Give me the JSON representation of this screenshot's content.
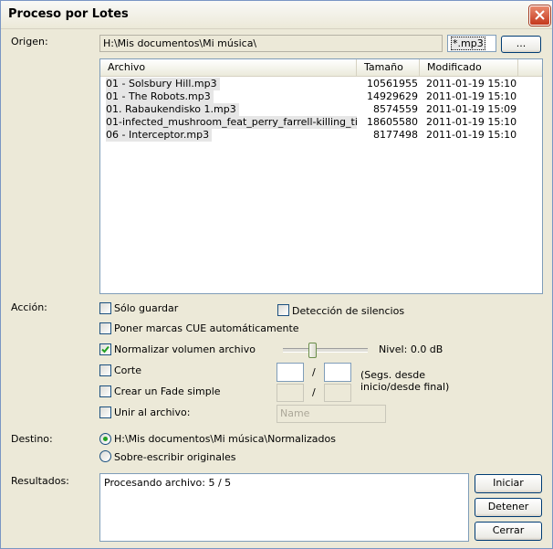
{
  "window": {
    "title": "Proceso por Lotes"
  },
  "origen": {
    "label": "Origen:",
    "path": "H:\\Mis documentos\\Mi música\\",
    "mask": "*.mp3",
    "browse_label": "..."
  },
  "files": {
    "columns": [
      "Archivo",
      "Tamaño",
      "Modificado"
    ],
    "rows": [
      {
        "name": "01 - Solsbury Hill.mp3",
        "size": "10561955",
        "modified": "2011-01-19  15:10"
      },
      {
        "name": "01 - The Robots.mp3",
        "size": "14929629",
        "modified": "2011-01-19  15:10"
      },
      {
        "name": "01. Rabaukendisko 1.mp3",
        "size": "8574559",
        "modified": "2011-01-19  15:09"
      },
      {
        "name": "01-infected_mushroom_feat_perry_farrell-killing_time_(p...",
        "size": "18605580",
        "modified": "2011-01-19  15:10"
      },
      {
        "name": "06 - Interceptor.mp3",
        "size": "8177498",
        "modified": "2011-01-19  15:10"
      }
    ]
  },
  "accion": {
    "label": "Acción:",
    "solo_guardar": {
      "label": "Sólo guardar",
      "checked": false
    },
    "deteccion": {
      "label": "Detección de silencios",
      "checked": false
    },
    "marcas_cue": {
      "label": "Poner marcas CUE automáticamente",
      "checked": false
    },
    "normalizar": {
      "label": "Normalizar volumen archivo",
      "checked": true
    },
    "nivel": "Nivel: 0.0 dB",
    "nivel_fraction": 0.36,
    "corte": {
      "label": "Corte",
      "checked": false
    },
    "fade": {
      "label": "Crear un Fade simple",
      "checked": false
    },
    "separator": "/",
    "segs_note": "(Segs. desde inicio/desde final)",
    "unir": {
      "label": "Unir al archivo:",
      "checked": false,
      "placeholder": "Name"
    }
  },
  "destino": {
    "label": "Destino:",
    "option1": {
      "label": "H:\\Mis documentos\\Mi música\\Normalizados",
      "selected": true
    },
    "option2": {
      "label": "Sobre-escribir originales",
      "selected": false
    }
  },
  "resultados": {
    "label": "Resultados:",
    "text": "Procesando archivo: 5 / 5",
    "iniciar": "Iniciar",
    "detener": "Detener",
    "cerrar": "Cerrar"
  },
  "colors": {
    "check": "#21a121",
    "accent": "#7f9db9",
    "close": "#c4381c"
  }
}
